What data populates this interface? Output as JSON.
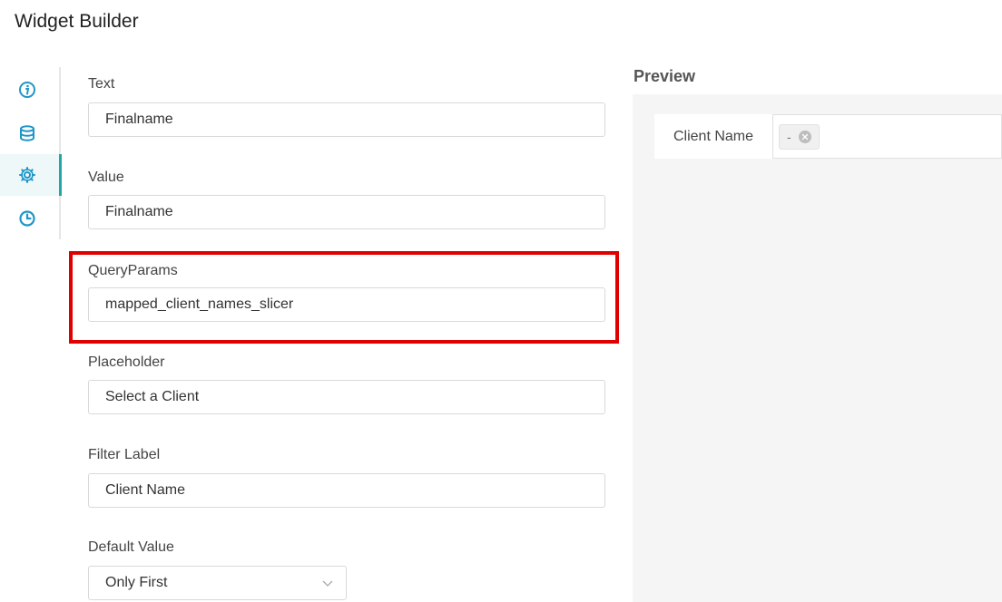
{
  "header": {
    "title": "Widget Builder"
  },
  "side_rail": {
    "items": [
      {
        "icon": "info-icon",
        "active": false
      },
      {
        "icon": "database-icon",
        "active": false
      },
      {
        "icon": "gear-icon",
        "active": true
      },
      {
        "icon": "clock-icon",
        "active": false
      }
    ],
    "accent_color": "#25a6a6",
    "icon_color": "#1e96c8"
  },
  "form": {
    "text": {
      "label": "Text",
      "value": "Finalname"
    },
    "value": {
      "label": "Value",
      "value": "Finalname"
    },
    "query_params": {
      "label": "QueryParams",
      "value": "mapped_client_names_slicer"
    },
    "placeholder": {
      "label": "Placeholder",
      "value": "Select a Client"
    },
    "filter_label": {
      "label": "Filter Label",
      "value": "Client Name"
    },
    "default_value": {
      "label": "Default Value",
      "selected": "Only First"
    }
  },
  "highlight_color": "#e00000",
  "preview": {
    "title": "Preview",
    "filter_label": "Client Name",
    "tag_text": "-"
  }
}
